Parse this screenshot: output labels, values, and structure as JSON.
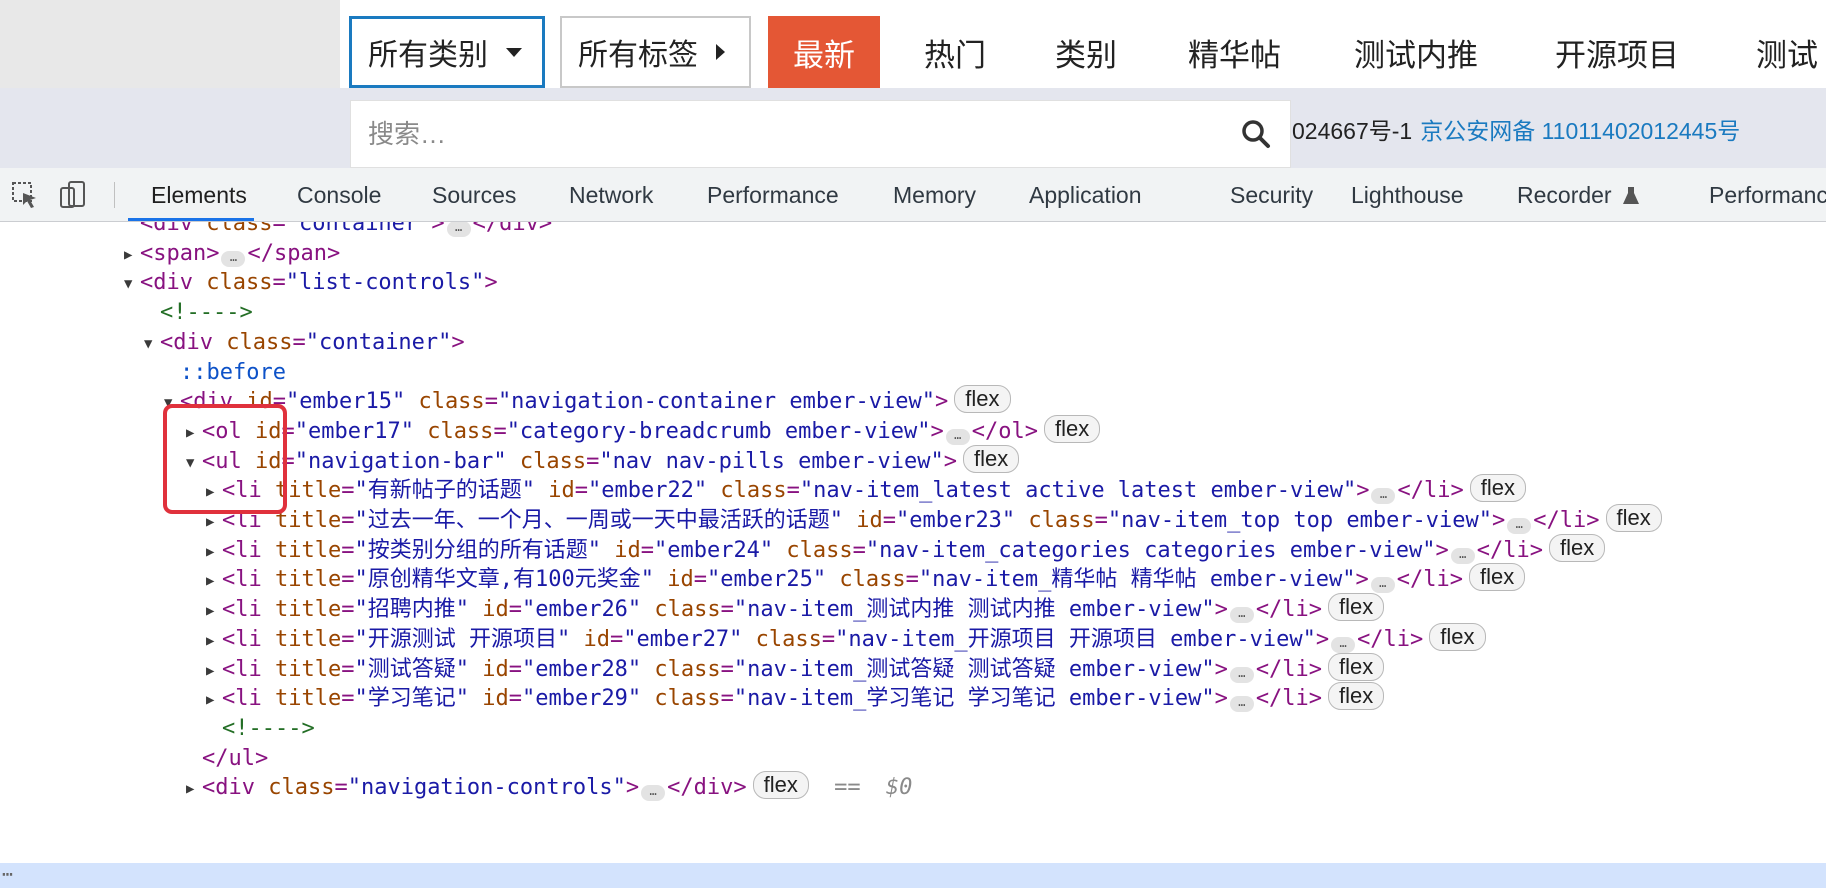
{
  "site": {
    "category_dropdown": "所有类别",
    "tag_dropdown": "所有标签",
    "pills": [
      "最新",
      "热门",
      "类别",
      "精华帖",
      "测试内推",
      "开源项目",
      "测试"
    ],
    "active_pill": "最新",
    "search_placeholder": "搜索…",
    "footer_text": "024667号-1",
    "footer_link": "京公安网备 11011402012445号",
    "colors": {
      "active_pill": "#e45735",
      "focus_border": "#1a7ac0",
      "link": "#1a7ac0"
    }
  },
  "devtools": {
    "tool_icons": [
      "inspect-element-icon",
      "device-toolbar-icon"
    ],
    "tabs": [
      "Elements",
      "Console",
      "Sources",
      "Network",
      "Performance",
      "Memory",
      "Application",
      "Security",
      "Lighthouse",
      "Recorder",
      "Performance"
    ],
    "active_tab": "Elements",
    "lines": [
      {
        "indent": 0,
        "tri": "",
        "segs": [
          {
            "c": "tag",
            "t": "<div "
          },
          {
            "c": "attr",
            "t": "class"
          },
          {
            "c": "tag",
            "t": "="
          },
          {
            "c": "val",
            "t": "\"container\""
          },
          {
            "c": "tag",
            "t": ">"
          },
          {
            "c": "ellip",
            "t": "…"
          },
          {
            "c": "tag",
            "t": "</div>"
          }
        ]
      },
      {
        "indent": 0,
        "tri": "▶",
        "segs": [
          {
            "c": "tag",
            "t": "<span>"
          },
          {
            "c": "ellip",
            "t": "…"
          },
          {
            "c": "tag",
            "t": "</span>"
          }
        ]
      },
      {
        "indent": 0,
        "tri": "▼",
        "segs": [
          {
            "c": "tag",
            "t": "<div "
          },
          {
            "c": "attr",
            "t": "class"
          },
          {
            "c": "tag",
            "t": "="
          },
          {
            "c": "val",
            "t": "\"list-controls\""
          },
          {
            "c": "tag",
            "t": ">"
          }
        ]
      },
      {
        "indent": 1,
        "tri": "",
        "segs": [
          {
            "c": "cmt",
            "t": "<!---->"
          }
        ]
      },
      {
        "indent": 1,
        "tri": "▼",
        "segs": [
          {
            "c": "tag",
            "t": "<div "
          },
          {
            "c": "attr",
            "t": "class"
          },
          {
            "c": "tag",
            "t": "="
          },
          {
            "c": "val",
            "t": "\"container\""
          },
          {
            "c": "tag",
            "t": ">"
          }
        ]
      },
      {
        "indent": 2,
        "tri": "",
        "segs": [
          {
            "c": "pseudo",
            "t": "::before"
          }
        ]
      },
      {
        "indent": 2,
        "tri": "▼",
        "segs": [
          {
            "c": "tag",
            "t": "<div "
          },
          {
            "c": "attr",
            "t": "id"
          },
          {
            "c": "tag",
            "t": "="
          },
          {
            "c": "val",
            "t": "\"ember15\""
          },
          {
            "c": "attr",
            "t": " class"
          },
          {
            "c": "tag",
            "t": "="
          },
          {
            "c": "val",
            "t": "\"navigation-container ember-view\""
          },
          {
            "c": "tag",
            "t": ">"
          },
          {
            "c": "badge",
            "t": "flex"
          }
        ]
      },
      {
        "indent": 3,
        "tri": "▶",
        "segs": [
          {
            "c": "tag",
            "t": "<ol "
          },
          {
            "c": "attr",
            "t": "id"
          },
          {
            "c": "tag",
            "t": "="
          },
          {
            "c": "val",
            "t": "\"ember17\""
          },
          {
            "c": "attr",
            "t": " class"
          },
          {
            "c": "tag",
            "t": "="
          },
          {
            "c": "val",
            "t": "\"category-breadcrumb ember-view\""
          },
          {
            "c": "tag",
            "t": ">"
          },
          {
            "c": "ellip",
            "t": "…"
          },
          {
            "c": "tag",
            "t": "</ol>"
          },
          {
            "c": "badge",
            "t": "flex"
          }
        ]
      },
      {
        "indent": 3,
        "tri": "▼",
        "segs": [
          {
            "c": "tag",
            "t": "<ul "
          },
          {
            "c": "attr",
            "t": "id"
          },
          {
            "c": "tag",
            "t": "="
          },
          {
            "c": "val",
            "t": "\"navigation-bar\""
          },
          {
            "c": "attr",
            "t": " class"
          },
          {
            "c": "tag",
            "t": "="
          },
          {
            "c": "val",
            "t": "\"nav nav-pills ember-view\""
          },
          {
            "c": "tag",
            "t": ">"
          },
          {
            "c": "badge",
            "t": "flex"
          }
        ]
      },
      {
        "indent": 4,
        "tri": "▶",
        "segs": [
          {
            "c": "tag",
            "t": "<li "
          },
          {
            "c": "attr",
            "t": "title"
          },
          {
            "c": "tag",
            "t": "="
          },
          {
            "c": "val",
            "t": "\"有新帖子的话题\""
          },
          {
            "c": "attr",
            "t": " id"
          },
          {
            "c": "tag",
            "t": "="
          },
          {
            "c": "val",
            "t": "\"ember22\""
          },
          {
            "c": "attr",
            "t": " class"
          },
          {
            "c": "tag",
            "t": "="
          },
          {
            "c": "val",
            "t": "\"nav-item_latest active latest ember-view\""
          },
          {
            "c": "tag",
            "t": ">"
          },
          {
            "c": "ellip",
            "t": "…"
          },
          {
            "c": "tag",
            "t": "</li>"
          },
          {
            "c": "badge",
            "t": "flex"
          }
        ]
      },
      {
        "indent": 4,
        "tri": "▶",
        "segs": [
          {
            "c": "tag",
            "t": "<li "
          },
          {
            "c": "attr",
            "t": "title"
          },
          {
            "c": "tag",
            "t": "="
          },
          {
            "c": "val",
            "t": "\"过去一年、一个月、一周或一天中最活跃的话题\""
          },
          {
            "c": "attr",
            "t": " id"
          },
          {
            "c": "tag",
            "t": "="
          },
          {
            "c": "val",
            "t": "\"ember23\""
          },
          {
            "c": "attr",
            "t": " class"
          },
          {
            "c": "tag",
            "t": "="
          },
          {
            "c": "val",
            "t": "\"nav-item_top top ember-view\""
          },
          {
            "c": "tag",
            "t": ">"
          },
          {
            "c": "ellip",
            "t": "…"
          },
          {
            "c": "tag",
            "t": "</li>"
          },
          {
            "c": "badge",
            "t": "flex"
          }
        ]
      },
      {
        "indent": 4,
        "tri": "▶",
        "segs": [
          {
            "c": "tag",
            "t": "<li "
          },
          {
            "c": "attr",
            "t": "title"
          },
          {
            "c": "tag",
            "t": "="
          },
          {
            "c": "val",
            "t": "\"按类别分组的所有话题\""
          },
          {
            "c": "attr",
            "t": " id"
          },
          {
            "c": "tag",
            "t": "="
          },
          {
            "c": "val",
            "t": "\"ember24\""
          },
          {
            "c": "attr",
            "t": " class"
          },
          {
            "c": "tag",
            "t": "="
          },
          {
            "c": "val",
            "t": "\"nav-item_categories categories ember-view\""
          },
          {
            "c": "tag",
            "t": ">"
          },
          {
            "c": "ellip",
            "t": "…"
          },
          {
            "c": "tag",
            "t": "</li>"
          },
          {
            "c": "badge",
            "t": "flex"
          }
        ]
      },
      {
        "indent": 4,
        "tri": "▶",
        "segs": [
          {
            "c": "tag",
            "t": "<li "
          },
          {
            "c": "attr",
            "t": "title"
          },
          {
            "c": "tag",
            "t": "="
          },
          {
            "c": "val",
            "t": "\"原创精华文章,有100元奖金\""
          },
          {
            "c": "attr",
            "t": " id"
          },
          {
            "c": "tag",
            "t": "="
          },
          {
            "c": "val",
            "t": "\"ember25\""
          },
          {
            "c": "attr",
            "t": " class"
          },
          {
            "c": "tag",
            "t": "="
          },
          {
            "c": "val",
            "t": "\"nav-item_精华帖 精华帖 ember-view\""
          },
          {
            "c": "tag",
            "t": ">"
          },
          {
            "c": "ellip",
            "t": "…"
          },
          {
            "c": "tag",
            "t": "</li>"
          },
          {
            "c": "badge",
            "t": "flex"
          }
        ]
      },
      {
        "indent": 4,
        "tri": "▶",
        "segs": [
          {
            "c": "tag",
            "t": "<li "
          },
          {
            "c": "attr",
            "t": "title"
          },
          {
            "c": "tag",
            "t": "="
          },
          {
            "c": "val",
            "t": "\"招聘内推\""
          },
          {
            "c": "attr",
            "t": " id"
          },
          {
            "c": "tag",
            "t": "="
          },
          {
            "c": "val",
            "t": "\"ember26\""
          },
          {
            "c": "attr",
            "t": " class"
          },
          {
            "c": "tag",
            "t": "="
          },
          {
            "c": "val",
            "t": "\"nav-item_测试内推 测试内推 ember-view\""
          },
          {
            "c": "tag",
            "t": ">"
          },
          {
            "c": "ellip",
            "t": "…"
          },
          {
            "c": "tag",
            "t": "</li>"
          },
          {
            "c": "badge",
            "t": "flex"
          }
        ]
      },
      {
        "indent": 4,
        "tri": "▶",
        "segs": [
          {
            "c": "tag",
            "t": "<li "
          },
          {
            "c": "attr",
            "t": "title"
          },
          {
            "c": "tag",
            "t": "="
          },
          {
            "c": "val",
            "t": "\"开源测试 开源项目\""
          },
          {
            "c": "attr",
            "t": " id"
          },
          {
            "c": "tag",
            "t": "="
          },
          {
            "c": "val",
            "t": "\"ember27\""
          },
          {
            "c": "attr",
            "t": " class"
          },
          {
            "c": "tag",
            "t": "="
          },
          {
            "c": "val",
            "t": "\"nav-item_开源项目 开源项目 ember-view\""
          },
          {
            "c": "tag",
            "t": ">"
          },
          {
            "c": "ellip",
            "t": "…"
          },
          {
            "c": "tag",
            "t": "</li>"
          },
          {
            "c": "badge",
            "t": "flex"
          }
        ]
      },
      {
        "indent": 4,
        "tri": "▶",
        "segs": [
          {
            "c": "tag",
            "t": "<li "
          },
          {
            "c": "attr",
            "t": "title"
          },
          {
            "c": "tag",
            "t": "="
          },
          {
            "c": "val",
            "t": "\"测试答疑\""
          },
          {
            "c": "attr",
            "t": " id"
          },
          {
            "c": "tag",
            "t": "="
          },
          {
            "c": "val",
            "t": "\"ember28\""
          },
          {
            "c": "attr",
            "t": " class"
          },
          {
            "c": "tag",
            "t": "="
          },
          {
            "c": "val",
            "t": "\"nav-item_测试答疑 测试答疑 ember-view\""
          },
          {
            "c": "tag",
            "t": ">"
          },
          {
            "c": "ellip",
            "t": "…"
          },
          {
            "c": "tag",
            "t": "</li>"
          },
          {
            "c": "badge",
            "t": "flex"
          }
        ]
      },
      {
        "indent": 4,
        "tri": "▶",
        "segs": [
          {
            "c": "tag",
            "t": "<li "
          },
          {
            "c": "attr",
            "t": "title"
          },
          {
            "c": "tag",
            "t": "="
          },
          {
            "c": "val",
            "t": "\"学习笔记\""
          },
          {
            "c": "attr",
            "t": " id"
          },
          {
            "c": "tag",
            "t": "="
          },
          {
            "c": "val",
            "t": "\"ember29\""
          },
          {
            "c": "attr",
            "t": " class"
          },
          {
            "c": "tag",
            "t": "="
          },
          {
            "c": "val",
            "t": "\"nav-item_学习笔记 学习笔记 ember-view\""
          },
          {
            "c": "tag",
            "t": ">"
          },
          {
            "c": "ellip",
            "t": "…"
          },
          {
            "c": "tag",
            "t": "</li>"
          },
          {
            "c": "badge",
            "t": "flex"
          }
        ]
      },
      {
        "indent": 4,
        "tri": "",
        "segs": [
          {
            "c": "cmt",
            "t": "<!---->"
          }
        ]
      },
      {
        "indent": 3,
        "tri": "",
        "segs": [
          {
            "c": "tag",
            "t": "</ul>"
          }
        ]
      },
      {
        "indent": 3,
        "tri": "▶",
        "segs": [
          {
            "c": "tag",
            "t": "<div "
          },
          {
            "c": "attr",
            "t": "class"
          },
          {
            "c": "tag",
            "t": "="
          },
          {
            "c": "val",
            "t": "\"navigation-controls\""
          },
          {
            "c": "tag",
            "t": ">"
          },
          {
            "c": "ellip",
            "t": "…"
          },
          {
            "c": "tag",
            "t": "</div>"
          },
          {
            "c": "badge",
            "t": "flex"
          },
          {
            "c": "eq",
            "t": " == "
          },
          {
            "c": "dollar",
            "t": "$0"
          }
        ]
      }
    ]
  }
}
